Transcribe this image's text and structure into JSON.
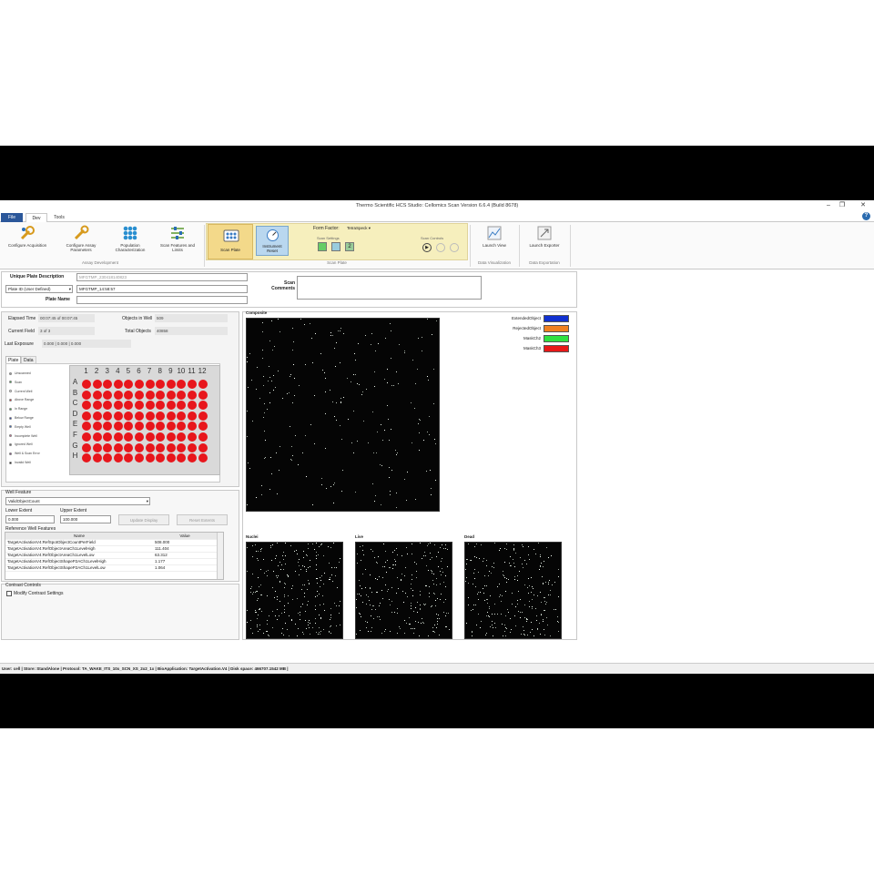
{
  "window": {
    "title": "Thermo Scientific HCS Studio: Cellomics Scan Version 6.6.4 (Build 8678)"
  },
  "ribbon": {
    "tabs": [
      "File",
      "Dev",
      "Tools"
    ],
    "buttons": {
      "configure_acquisition": "Configure Acquisition",
      "configure_assay": "Configure Assay Parameters",
      "population": "Population Characterization",
      "scan_features": "Scan Features and Limits",
      "scan_plate": "Scan Plate",
      "instrument_reset": "Instrument Reset",
      "launch_view": "Launch View",
      "launch_exporter": "Launch Exporter"
    },
    "groups": {
      "assay_dev": "Assay Development",
      "scan_plate": "Scan Plate",
      "data_vis": "Data Visualization",
      "data_exp": "Data Exportation"
    },
    "form_factor_label": "Form Factor:",
    "form_factor_value": "TetraSpeck",
    "scan_settings": "Scan Settings",
    "scan_controls": "Scan Controls"
  },
  "plate_info": {
    "unique_desc_label": "Unique Plate Description",
    "unique_desc_value": "MFGTMP_230418140823",
    "plate_id_select": "Plate ID (User Defined)",
    "plate_id_value": "MFGTMP_14:58:57",
    "plate_name_label": "Plate Name",
    "plate_name_value": "",
    "scan_comments_label": "Scan Comments"
  },
  "scan_status": {
    "elapsed_label": "Elapsed Time",
    "elapsed_value": "00:07:45 of 00:07:45",
    "field_label": "Current Field",
    "field_value": "3 of 3",
    "exposure_label": "Last Exposure",
    "exposure_value": "0.000 | 0.000 | 0.000",
    "objects_label": "Objects in Well",
    "objects_value": "509",
    "total_label": "Total Objects",
    "total_value": "40858"
  },
  "plate_tabs": [
    "Plate",
    "Data"
  ],
  "plate": {
    "columns": [
      "1",
      "2",
      "3",
      "4",
      "5",
      "6",
      "7",
      "8",
      "9",
      "10",
      "11",
      "12"
    ],
    "rows": [
      "A",
      "B",
      "C",
      "D",
      "E",
      "F",
      "G",
      "H"
    ],
    "legend": [
      {
        "label": "Unscanned",
        "color": "#aaaaaa"
      },
      {
        "label": "Scan",
        "color": "#30b040"
      },
      {
        "label": "Current Well",
        "color": "#ffffff"
      },
      {
        "label": "Above Range",
        "color": "#e8161c"
      },
      {
        "label": "In Range",
        "color": "#30b040"
      },
      {
        "label": "Below Range",
        "color": "#1030c0"
      },
      {
        "label": "Empty Well",
        "color": "#2060d0"
      },
      {
        "label": "Incomplete Well",
        "color": "#e06090"
      },
      {
        "label": "Ignored Well",
        "color": "#666666"
      },
      {
        "label": "Well & Scan Error",
        "color": "#884488"
      },
      {
        "label": "Invalid Well",
        "color": "#000000"
      }
    ]
  },
  "well_feature": {
    "label": "Well Feature",
    "value": "ValidObjectCount",
    "lower_label": "Lower Extent",
    "lower_value": "0.000",
    "upper_label": "Upper Extent",
    "upper_value": "100.000",
    "update_btn": "Update Display",
    "reset_btn": "Reset Extents",
    "ref_label": "Reference Well Features",
    "table_headers": [
      "Name",
      "Value"
    ],
    "rows": [
      {
        "name": "TargetActivationV4:RefSpotObjectCountPerField",
        "value": "508.000"
      },
      {
        "name": "TargetActivationV4:RefObjectAreaCh1LevelHigh",
        "value": "111.404"
      },
      {
        "name": "TargetActivationV4:RefObjectAreaCh1LevelLow",
        "value": "63.312"
      },
      {
        "name": "TargetActivationV4:RefObjectShapeP2ACh1LevelHigh",
        "value": "1.177"
      },
      {
        "name": "TargetActivationV4:RefObjectShapeP2ACh1LevelLow",
        "value": "1.064"
      }
    ]
  },
  "contrast": {
    "label": "Contrast Controls",
    "checkbox": "Modify Contrast Settings"
  },
  "images": {
    "composite": "Composite",
    "nuclei": "Nuclei",
    "live": "Live",
    "dead": "Dead"
  },
  "legend": [
    {
      "label": "ExtendedObject",
      "color": "#1030d0"
    },
    {
      "label": "RejectedObject",
      "color": "#f08020"
    },
    {
      "label": "MaskCh2",
      "color": "#30e040"
    },
    {
      "label": "MaskCh3",
      "color": "#e81818"
    }
  ],
  "statusbar": "User: cell | Store: StandAlone | Protocol: TA_WAKE_ITS_10x_SCN_XS_2x2_1x | BioApplication: TargetActivation.V4 | Disk space: 466707.1542 MB |"
}
